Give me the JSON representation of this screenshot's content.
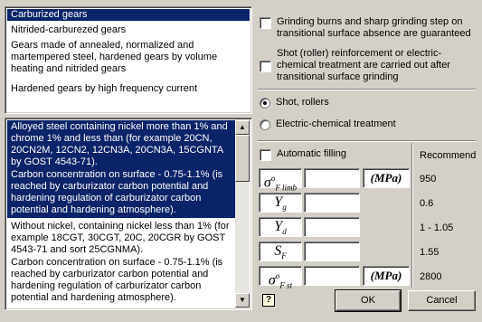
{
  "gear_types": {
    "items": [
      {
        "label": "Carburized gears",
        "selected": true
      },
      {
        "label": "Nitrided-carburezed gears",
        "selected": false
      },
      {
        "label": "Gears made of annealed, normalized and martempered steel, hardened gears by volume heating and nitrided gears",
        "selected": false
      },
      {
        "label": "Hardened gears by high frequency current",
        "selected": false
      }
    ]
  },
  "steel_list": {
    "items": [
      {
        "selected": true,
        "line1": "Alloyed steel containing nickel more than 1% and chrome 1% and less than (for example 20CN, 20CN2M, 12CN2, 12CN3A, 20CN3A, 15CGNTA by GOST 4543-71).",
        "line2": "Carbon concentration on surface - 0.75-1.1% (is reached by carburizator carbon potential and hardening regulation of carburizator carbon potential and hardening atmosphere)."
      },
      {
        "selected": false,
        "line1": "Without nickel, containing nickel less than 1% (for example 18CGT, 30CGT, 20C, 20CGR by GOST 4543-71 and sort 25CGNMA).",
        "line2": "Carbon concentration on surface - 0.75-1.1% (is reached by carburizator carbon potential and hardening regulation of carburizator carbon potential and hardening atmosphere)."
      }
    ],
    "scroll_up": "▲",
    "scroll_down": "▼"
  },
  "options": {
    "grinding_burns": "Grinding burns and sharp grinding step on transitional surface absence are guaranteed",
    "shot_reinforcement": "Shot (roller) reinforcement or electric-chemical treatment are carried out after transitional surface grinding",
    "shot_rollers": "Shot, rollers",
    "electric_chemical": "Electric-chemical treatment",
    "automatic_filling": "Automatic filling",
    "recommend_header": "Recommend"
  },
  "parameters": [
    {
      "symbol": "σ",
      "sup": "o",
      "sub": "F limb",
      "unit": "(MPa)",
      "value": "",
      "recommend": "950"
    },
    {
      "symbol": "Y",
      "sup": "",
      "sub": "g",
      "unit": "",
      "value": "",
      "recommend": "0.6"
    },
    {
      "symbol": "Y",
      "sup": "",
      "sub": "d",
      "unit": "",
      "value": "",
      "recommend": "1 - 1.05"
    },
    {
      "symbol": "S",
      "sup": "",
      "sub": "F",
      "unit": "",
      "value": "",
      "recommend": "1.55"
    },
    {
      "symbol": "σ",
      "sup": "o",
      "sub": "F st",
      "unit": "(MPa)",
      "value": "",
      "recommend": "2800"
    }
  ],
  "buttons": {
    "help": "?",
    "ok": "OK",
    "cancel": "Cancel"
  }
}
